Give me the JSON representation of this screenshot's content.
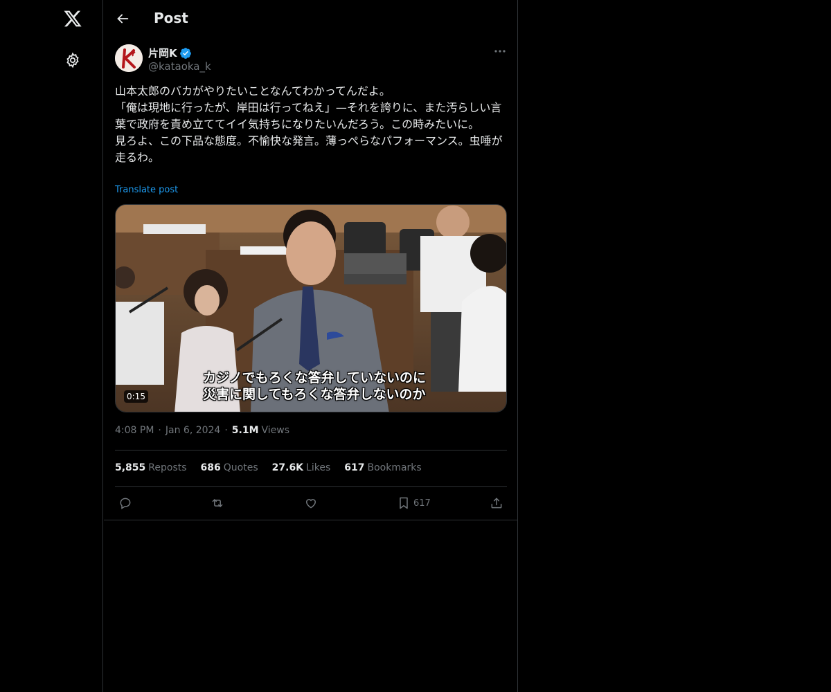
{
  "nav": {
    "logo": "x-logo-icon",
    "settings": "gear-icon"
  },
  "header": {
    "title": "Post"
  },
  "author": {
    "name": "片岡K",
    "handle": "@kataoka_k",
    "verified_color": "#1d9bf0"
  },
  "post": {
    "text": "山本太郎のバカがやりたいことなんてわかってんだよ。\n「俺は現地に行ったが、岸田は行ってねえ」—それを誇りに、また汚らしい言葉で政府を責め立ててイイ気持ちになりたいんだろう。この時みたいに。\n見ろよ、この下品な態度。不愉快な発言。薄っぺらなパフォーマンス。虫唾が走るわ。",
    "translate_label": "Translate post",
    "video": {
      "subtitle_line1": "カジノでもろくな答弁していないのに",
      "subtitle_line2": "災害に関してもろくな答弁しないのか",
      "duration": "0:15"
    },
    "time": "4:08 PM",
    "date": "Jan 6, 2024",
    "views_count": "5.1M",
    "views_label": "Views"
  },
  "stats": {
    "reposts_count": "5,855",
    "reposts_label": "Reposts",
    "quotes_count": "686",
    "quotes_label": "Quotes",
    "likes_count": "27.6K",
    "likes_label": "Likes",
    "bookmarks_count": "617",
    "bookmarks_label": "Bookmarks"
  },
  "actions": {
    "bookmark_count": "617"
  },
  "colors": {
    "background": "#000000",
    "text": "#e7e9ea",
    "secondary": "#71767b",
    "accent": "#1d9bf0",
    "border": "#2f3336"
  }
}
